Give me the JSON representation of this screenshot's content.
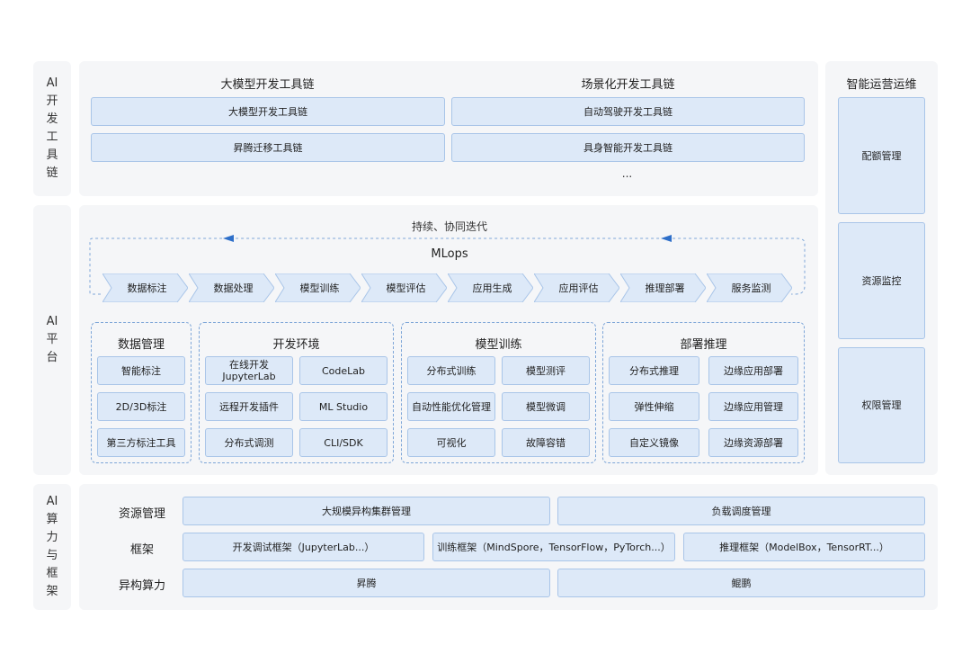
{
  "left_labels": {
    "toolchain": "AI\n开\n发\n工\n具\n链",
    "platform": "AI\n平\n台",
    "compute": "AI\n算\n力\n与\n框\n架"
  },
  "toolchain": {
    "group1_title": "大模型开发工具链",
    "group2_title": "场景化开发工具链",
    "items": [
      "大模型开发工具链",
      "自动驾驶开发工具链",
      "昇腾迁移工具链",
      "具身智能开发工具链"
    ],
    "ellipsis": "..."
  },
  "ops": {
    "title": "智能运营运维",
    "items": [
      "配额管理",
      "资源监控",
      "权限管理"
    ]
  },
  "mlops": {
    "loop_label": "持续、协同迭代",
    "title": "MLops",
    "steps": [
      "数据标注",
      "数据处理",
      "模型训练",
      "模型评估",
      "应用生成",
      "应用评估",
      "推理部署",
      "服务监测"
    ]
  },
  "modules": {
    "data": {
      "title": "数据管理",
      "items": [
        "智能标注",
        "2D/3D标注",
        "第三方标注工具"
      ]
    },
    "dev": {
      "title": "开发环境",
      "items": [
        "在线开发\nJupyterLab",
        "CodeLab",
        "远程开发插件",
        "ML Studio",
        "分布式调测",
        "CLI/SDK"
      ]
    },
    "train": {
      "title": "模型训练",
      "items": [
        "分布式训练",
        "模型测评",
        "自动性能优化管理",
        "模型微调",
        "可视化",
        "故障容错"
      ]
    },
    "deploy": {
      "title": "部署推理",
      "items": [
        "分布式推理",
        "边缘应用部署",
        "弹性伸缩",
        "边缘应用管理",
        "自定义镜像",
        "边缘资源部署"
      ]
    }
  },
  "compute": {
    "row1_label": "资源管理",
    "row2_label": "框架",
    "row3_label": "异构算力",
    "row1": [
      "大规模异构集群管理",
      "负载调度管理"
    ],
    "row2": [
      "开发调试框架（JupyterLab...）",
      "训练框架（MindSpore，TensorFlow，PyTorch...）",
      "推理框架（ModelBox，TensorRT...）"
    ],
    "row3": [
      "昇腾",
      "鲲鹏"
    ]
  },
  "colors": {
    "panel": "#f5f6f8",
    "box_fill": "#dde9f8",
    "box_border": "#a9c5e8",
    "accent": "#2e6fc9"
  }
}
